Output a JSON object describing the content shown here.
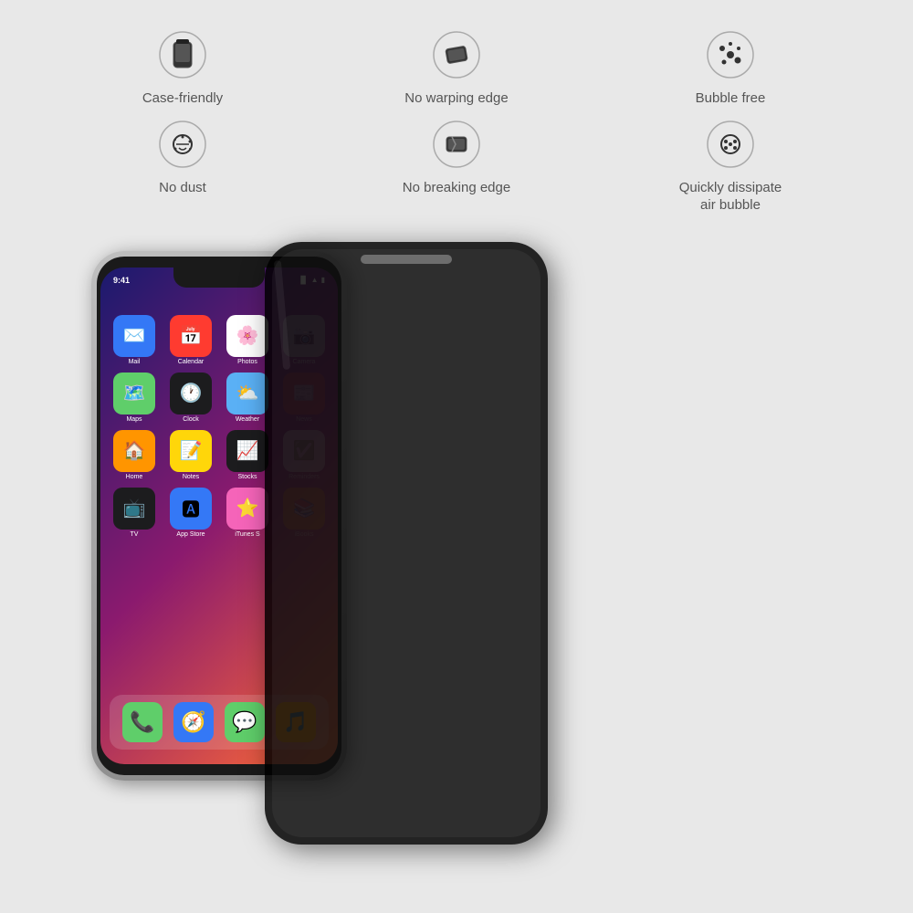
{
  "features": [
    {
      "id": "case-friendly",
      "label": "Case-friendly",
      "icon": "case"
    },
    {
      "id": "no-warping-edge",
      "label": "No warping edge",
      "icon": "no-warp"
    },
    {
      "id": "bubble-free",
      "label": "Bubble free",
      "icon": "bubble"
    },
    {
      "id": "no-dust",
      "label": "No dust",
      "icon": "dust"
    },
    {
      "id": "no-breaking-edge",
      "label": "No breaking edge",
      "icon": "break"
    },
    {
      "id": "quickly-dissipate",
      "label": "Quickly dissipate\nair bubble",
      "icon": "dissipate"
    }
  ],
  "phone": {
    "status_time": "9:41",
    "apps": [
      {
        "label": "Mail",
        "bg": "#3478f6",
        "emoji": "✉️"
      },
      {
        "label": "Calendar",
        "bg": "#ff3b30",
        "emoji": "📅"
      },
      {
        "label": "Photos",
        "bg": "#fff",
        "emoji": "🌸"
      },
      {
        "label": "Camera",
        "bg": "#c8c8c8",
        "emoji": "📷"
      },
      {
        "label": "Maps",
        "bg": "#5fce6a",
        "emoji": "🗺️"
      },
      {
        "label": "Clock",
        "bg": "#1c1c1e",
        "emoji": "🕐"
      },
      {
        "label": "Weather",
        "bg": "#5ab0f5",
        "emoji": "⛅"
      },
      {
        "label": "News",
        "bg": "#ff3b30",
        "emoji": "📰"
      },
      {
        "label": "Home",
        "bg": "#ff9500",
        "emoji": "🏠"
      },
      {
        "label": "Notes",
        "bg": "#ffd60a",
        "emoji": "📝"
      },
      {
        "label": "Stocks",
        "bg": "#1c1c1e",
        "emoji": "📈"
      },
      {
        "label": "Reminders",
        "bg": "#fff",
        "emoji": "✅"
      },
      {
        "label": "TV",
        "bg": "#1c1c1e",
        "emoji": "📺"
      },
      {
        "label": "App Store",
        "bg": "#3478f6",
        "emoji": "🅰"
      },
      {
        "label": "iTunes S",
        "bg": "#f564b9",
        "emoji": "⭐"
      },
      {
        "label": "iBooks",
        "bg": "#ff9500",
        "emoji": "📚"
      }
    ],
    "dock": [
      {
        "emoji": "📞",
        "bg": "#5fce6a"
      },
      {
        "emoji": "🧭",
        "bg": "#3478f6"
      },
      {
        "emoji": "💬",
        "bg": "#5fce6a"
      },
      {
        "emoji": "🎵",
        "bg": "#ff9500"
      }
    ]
  }
}
